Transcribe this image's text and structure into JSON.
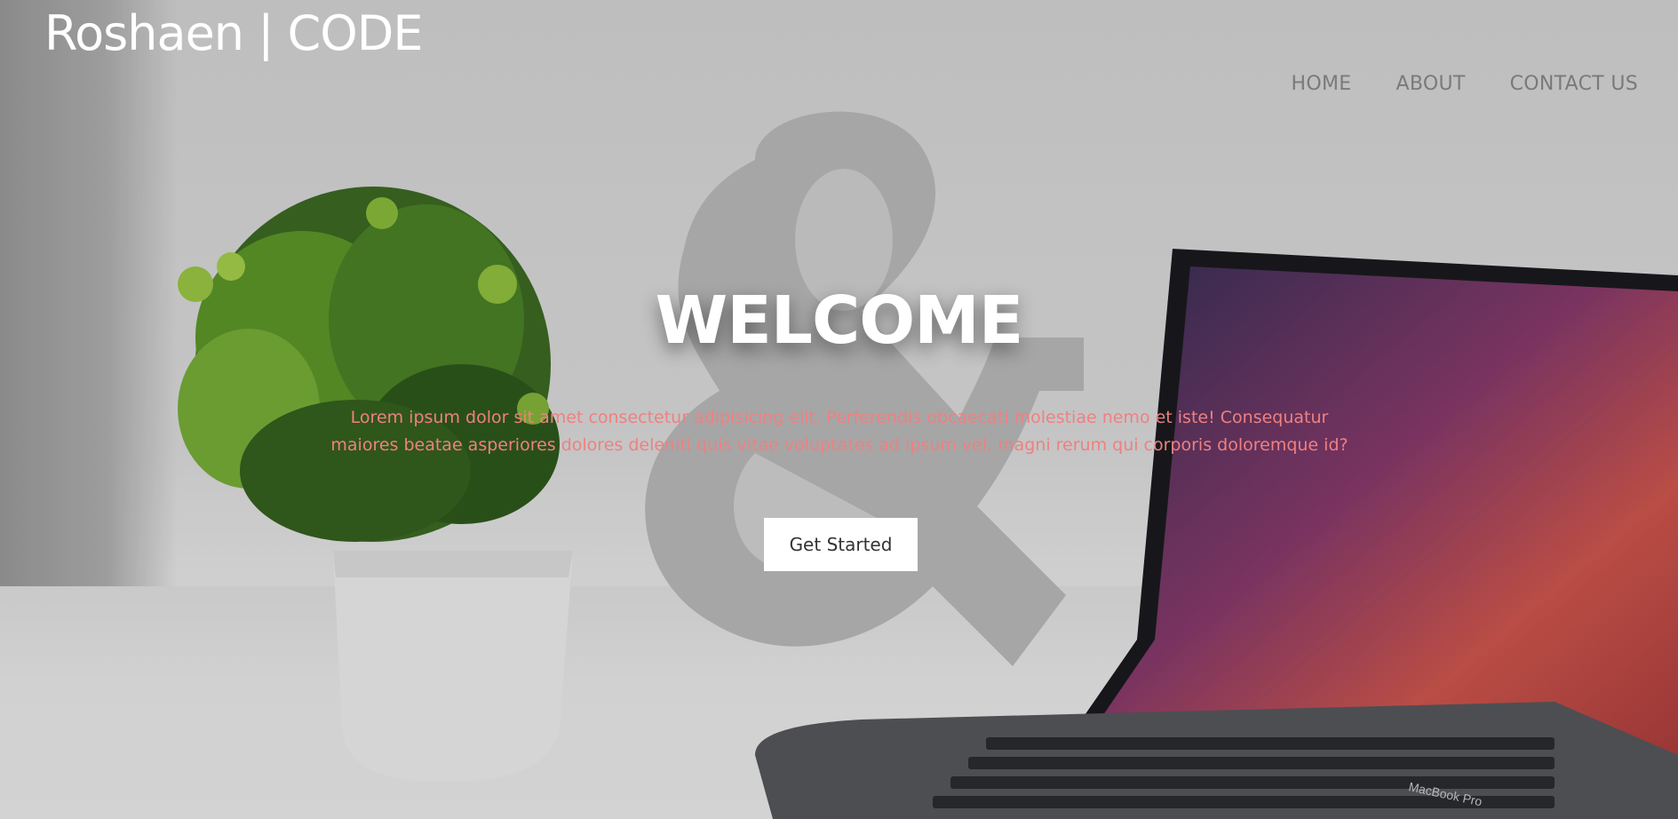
{
  "brand": {
    "title": "Roshaen | CODE"
  },
  "nav": {
    "items": [
      {
        "label": "HOME"
      },
      {
        "label": "ABOUT"
      },
      {
        "label": "CONTACT US"
      }
    ]
  },
  "hero": {
    "heading": "WELCOME",
    "lead": "Lorem ipsum dolor sit amet consectetur adipisicing elit. Perferendis obcaecati molestiae nemo et iste! Consequatur maiores beatae asperiores dolores deleniti quis vitae voluptates ad ipsum vel, magni rerum qui corporis doloremque id?",
    "cta_label": "Get Started",
    "background_image": "desk-with-plant-ampersand-and-laptop",
    "laptop_label": "MacBook Pro"
  },
  "colors": {
    "brand_text": "#ffffff",
    "nav_text": "#7a7a7a",
    "lead_text": "#f08080",
    "button_bg": "#ffffff",
    "button_text": "#333333"
  }
}
